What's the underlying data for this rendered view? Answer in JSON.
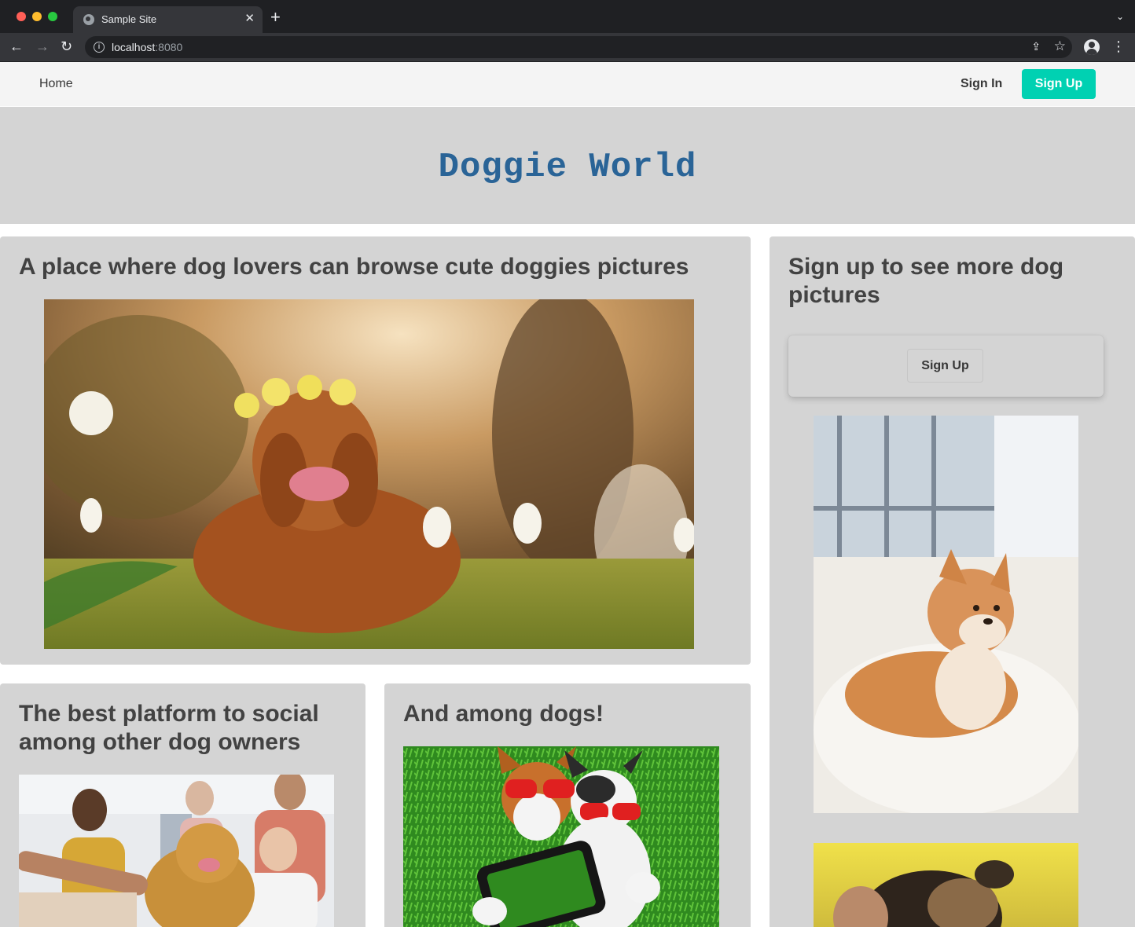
{
  "browser": {
    "tab_title": "Sample Site",
    "tab_close": "✕",
    "new_tab": "+",
    "url_host": "localhost",
    "url_port": ":8080"
  },
  "navbar": {
    "home": "Home",
    "sign_in": "Sign In",
    "sign_up": "Sign Up"
  },
  "hero": {
    "title": "Doggie World"
  },
  "main_card": {
    "title": "A place where dog lovers can browse cute doggies pictures",
    "photo": "golden-retriever-flower-crown-photo"
  },
  "side_card": {
    "title": "Sign up to see more dog pictures",
    "button": "Sign Up",
    "photos": [
      "shiba-inu-on-fur-rug-photo",
      "dog-being-petted-photo"
    ]
  },
  "social_card": {
    "title": "The best platform to social among other dog owners",
    "photo": "people-with-golden-retriever-photo"
  },
  "dogs_card": {
    "title": "And among dogs!",
    "photo": "dogs-selfie-sunglasses-photo"
  }
}
